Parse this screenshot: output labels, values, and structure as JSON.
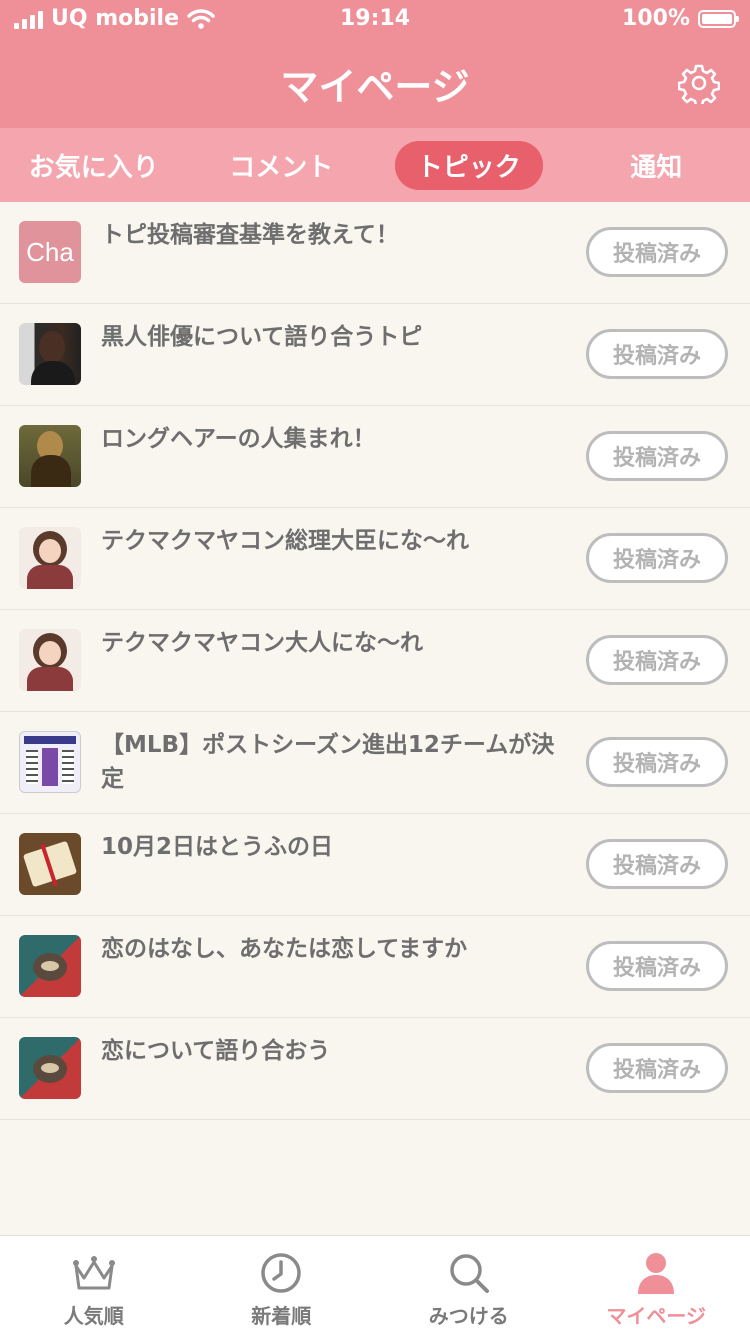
{
  "status_bar": {
    "carrier": "UQ mobile",
    "time": "19:14",
    "battery": "100%"
  },
  "header": {
    "title": "マイページ",
    "settings_icon": "gear-icon"
  },
  "tabs": [
    {
      "label": "お気に入り",
      "active": false
    },
    {
      "label": "コメント",
      "active": false
    },
    {
      "label": "トピック",
      "active": true
    },
    {
      "label": "通知",
      "active": false
    }
  ],
  "topics": [
    {
      "title": "トピ投稿審査基準を教えて！",
      "button": "投稿済み",
      "thumb_text": "Cha"
    },
    {
      "title": "黒人俳優について語り合うトピ",
      "button": "投稿済み"
    },
    {
      "title": "ロングヘアーの人集まれ！",
      "button": "投稿済み"
    },
    {
      "title": "テクマクマヤコン総理大臣にな〜れ",
      "button": "投稿済み"
    },
    {
      "title": "テクマクマヤコン大人にな〜れ",
      "button": "投稿済み"
    },
    {
      "title": "【MLB】ポストシーズン進出12チームが決定",
      "button": "投稿済み"
    },
    {
      "title": "10月2日はとうふの日",
      "button": "投稿済み"
    },
    {
      "title": "恋のはなし、あなたは恋してますか",
      "button": "投稿済み"
    },
    {
      "title": "恋について語り合おう",
      "button": "投稿済み"
    }
  ],
  "bottom_nav": [
    {
      "label": "人気順",
      "icon": "crown-icon",
      "active": false
    },
    {
      "label": "新着順",
      "icon": "clock-icon",
      "active": false
    },
    {
      "label": "みつける",
      "icon": "search-icon",
      "active": false
    },
    {
      "label": "マイページ",
      "icon": "person-icon",
      "active": true
    }
  ],
  "colors": {
    "header": "#ef8f98",
    "tab_bar": "#f4a5ad",
    "tab_active": "#e9606d",
    "background": "#f9f6f0"
  }
}
